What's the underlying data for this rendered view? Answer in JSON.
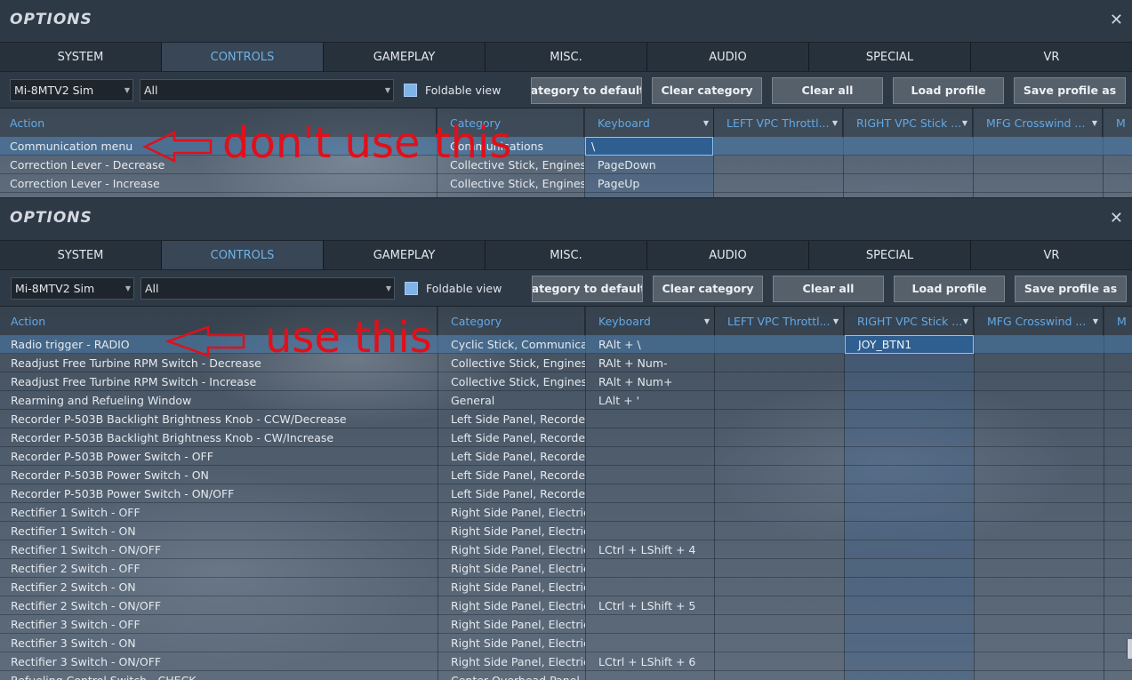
{
  "top": {
    "window_title": "OPTIONS",
    "close_label": "✕",
    "tabs": [
      "SYSTEM",
      "CONTROLS",
      "GAMEPLAY",
      "MISC.",
      "AUDIO",
      "SPECIAL",
      "VR"
    ],
    "active_tab": "CONTROLS",
    "aircraft_select": "Mi-8MTV2 Sim",
    "category_select": "All",
    "foldable_label": "Foldable view",
    "buttons": {
      "reset": "set category to default",
      "clear_category": "Clear category",
      "clear_all": "Clear all",
      "load_profile": "Load profile",
      "save_profile": "Save profile as"
    },
    "columns": [
      "Action",
      "Category",
      "Keyboard",
      "LEFT VPC Throttl...",
      "RIGHT VPC Stick ...",
      "MFG Crosswind ...",
      "M"
    ],
    "rows": [
      {
        "action": "Communication menu",
        "category": "Communications",
        "keyboard": "\\"
      },
      {
        "action": "Correction Lever - Decrease",
        "category": "Collective Stick, Engines",
        "keyboard": "PageDown"
      },
      {
        "action": "Correction Lever - Increase",
        "category": "Collective Stick, Engines",
        "keyboard": "PageUp"
      }
    ],
    "annotation": "don't use this"
  },
  "bottom": {
    "window_title": "OPTIONS",
    "close_label": "✕",
    "tabs": [
      "SYSTEM",
      "CONTROLS",
      "GAMEPLAY",
      "MISC.",
      "AUDIO",
      "SPECIAL",
      "VR"
    ],
    "active_tab": "CONTROLS",
    "aircraft_select": "Mi-8MTV2 Sim",
    "category_select": "All",
    "foldable_label": "Foldable view",
    "buttons": {
      "reset": "set category to default",
      "clear_category": "Clear category",
      "clear_all": "Clear all",
      "load_profile": "Load profile",
      "save_profile": "Save profile as"
    },
    "columns": [
      "Action",
      "Category",
      "Keyboard",
      "LEFT VPC Throttl...",
      "RIGHT VPC Stick ...",
      "MFG Crosswind ...",
      "M"
    ],
    "rows": [
      {
        "action": "Radio trigger - RADIO",
        "category": "Cyclic Stick, Communications",
        "keyboard": "RAlt + \\",
        "right_stick": "JOY_BTN1"
      },
      {
        "action": "Readjust Free Turbine RPM Switch - Decrease",
        "category": "Collective Stick, Engines",
        "keyboard": "RAlt + Num-",
        "right_stick": ""
      },
      {
        "action": "Readjust Free Turbine RPM Switch - Increase",
        "category": "Collective Stick, Engines",
        "keyboard": "RAlt + Num+",
        "right_stick": ""
      },
      {
        "action": "Rearming and Refueling Window",
        "category": "General",
        "keyboard": "LAlt + '",
        "right_stick": ""
      },
      {
        "action": "Recorder P-503B Backlight Brightness Knob - CCW/Decrease",
        "category": "Left Side Panel, Recorder",
        "keyboard": "",
        "right_stick": ""
      },
      {
        "action": "Recorder P-503B Backlight Brightness Knob - CW/Increase",
        "category": "Left Side Panel, Recorder",
        "keyboard": "",
        "right_stick": ""
      },
      {
        "action": "Recorder P-503B Power Switch - OFF",
        "category": "Left Side Panel, Recorder",
        "keyboard": "",
        "right_stick": ""
      },
      {
        "action": "Recorder P-503B Power Switch - ON",
        "category": "Left Side Panel, Recorder",
        "keyboard": "",
        "right_stick": ""
      },
      {
        "action": "Recorder P-503B Power Switch - ON/OFF",
        "category": "Left Side Panel, Recorder",
        "keyboard": "",
        "right_stick": ""
      },
      {
        "action": "Rectifier 1 Switch - OFF",
        "category": "Right Side Panel, Electric Power",
        "keyboard": "",
        "right_stick": ""
      },
      {
        "action": "Rectifier 1 Switch - ON",
        "category": "Right Side Panel, Electric Power",
        "keyboard": "",
        "right_stick": ""
      },
      {
        "action": "Rectifier 1 Switch - ON/OFF",
        "category": "Right Side Panel, Electric Power",
        "keyboard": "LCtrl + LShift + 4",
        "right_stick": ""
      },
      {
        "action": "Rectifier 2 Switch - OFF",
        "category": "Right Side Panel, Electric Power",
        "keyboard": "",
        "right_stick": ""
      },
      {
        "action": "Rectifier 2 Switch - ON",
        "category": "Right Side Panel, Electric Power",
        "keyboard": "",
        "right_stick": ""
      },
      {
        "action": "Rectifier 2 Switch - ON/OFF",
        "category": "Right Side Panel, Electric Power",
        "keyboard": "LCtrl + LShift + 5",
        "right_stick": ""
      },
      {
        "action": "Rectifier 3 Switch - OFF",
        "category": "Right Side Panel, Electric Power",
        "keyboard": "",
        "right_stick": ""
      },
      {
        "action": "Rectifier 3 Switch - ON",
        "category": "Right Side Panel, Electric Power",
        "keyboard": "",
        "right_stick": ""
      },
      {
        "action": "Rectifier 3 Switch - ON/OFF",
        "category": "Right Side Panel, Electric Power",
        "keyboard": "LCtrl + LShift + 6",
        "right_stick": ""
      },
      {
        "action": "Refueling Control Switch - CHECK",
        "category": "Center Overhead Panel, Fuel",
        "keyboard": "",
        "right_stick": ""
      }
    ],
    "annotation": "use this"
  },
  "colors": {
    "annotation_red": "#e0101a",
    "accent_blue": "#62a9e6",
    "active_tab_text": "#6fb2e6"
  }
}
